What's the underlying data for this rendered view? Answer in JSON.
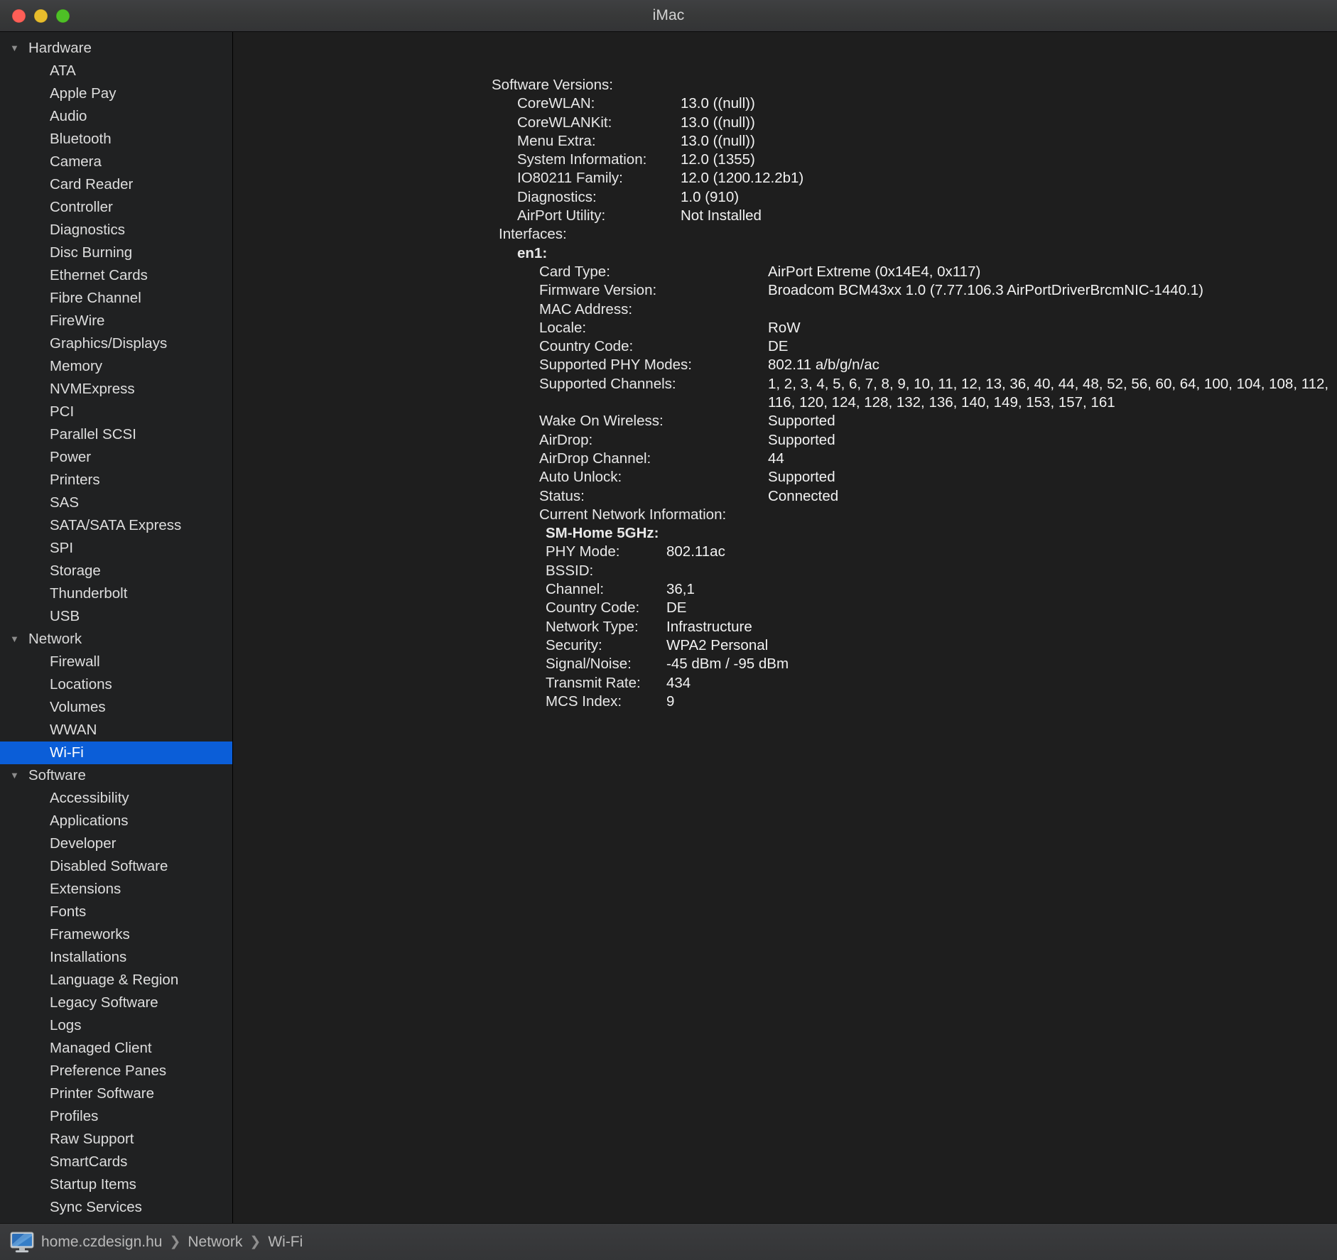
{
  "window": {
    "title": "iMac",
    "traffic_lights": [
      "close-button",
      "minimize-button",
      "zoom-button"
    ],
    "accent_selection_color": "#0b5ed8",
    "sidebar_bg": "#202122",
    "content_bg": "#1e1e1e"
  },
  "sidebar": {
    "groups": [
      {
        "label": "Hardware",
        "disclosure": "▼",
        "items": [
          "ATA",
          "Apple Pay",
          "Audio",
          "Bluetooth",
          "Camera",
          "Card Reader",
          "Controller",
          "Diagnostics",
          "Disc Burning",
          "Ethernet Cards",
          "Fibre Channel",
          "FireWire",
          "Graphics/Displays",
          "Memory",
          "NVMExpress",
          "PCI",
          "Parallel SCSI",
          "Power",
          "Printers",
          "SAS",
          "SATA/SATA Express",
          "SPI",
          "Storage",
          "Thunderbolt",
          "USB"
        ]
      },
      {
        "label": "Network",
        "disclosure": "▼",
        "items": [
          "Firewall",
          "Locations",
          "Volumes",
          "WWAN",
          "Wi-Fi"
        ]
      },
      {
        "label": "Software",
        "disclosure": "▼",
        "items": [
          "Accessibility",
          "Applications",
          "Developer",
          "Disabled Software",
          "Extensions",
          "Fonts",
          "Frameworks",
          "Installations",
          "Language & Region",
          "Legacy Software",
          "Logs",
          "Managed Client",
          "Preference Panes",
          "Printer Software",
          "Profiles",
          "Raw Support",
          "SmartCards",
          "Startup Items",
          "Sync Services"
        ]
      }
    ],
    "selected": "Wi-Fi"
  },
  "report": {
    "software_versions_heading": "Software Versions:",
    "software_versions": [
      {
        "key": "CoreWLAN:",
        "value": "13.0 ((null))"
      },
      {
        "key": "CoreWLANKit:",
        "value": "13.0 ((null))"
      },
      {
        "key": "Menu Extra:",
        "value": "13.0 ((null))"
      },
      {
        "key": "System Information:",
        "value": "12.0 (1355)"
      },
      {
        "key": "IO80211 Family:",
        "value": "12.0 (1200.12.2b1)"
      },
      {
        "key": "Diagnostics:",
        "value": "1.0 (910)"
      },
      {
        "key": "AirPort Utility:",
        "value": "Not Installed"
      }
    ],
    "interfaces_heading": "Interfaces:",
    "interface_name": "en1:",
    "interface_rows": [
      {
        "key": "Card Type:",
        "value": "AirPort Extreme  (0x14E4, 0x117)"
      },
      {
        "key": "Firmware Version:",
        "value": "Broadcom BCM43xx 1.0 (7.77.106.3 AirPortDriverBrcmNIC-1440.1)"
      },
      {
        "key": "MAC Address:",
        "value": ""
      },
      {
        "key": "Locale:",
        "value": "RoW"
      },
      {
        "key": "Country Code:",
        "value": "DE"
      },
      {
        "key": "Supported PHY Modes:",
        "value": "802.11 a/b/g/n/ac"
      }
    ],
    "supported_channels_key": "Supported Channels:",
    "supported_channels_value": "1, 2, 3, 4, 5, 6, 7, 8, 9, 10, 11, 12, 13, 36, 40, 44, 48, 52, 56, 60, 64, 100, 104, 108, 112, 116, 120, 124, 128, 132, 136, 140, 149, 153, 157, 161",
    "interface_rows_2": [
      {
        "key": "Wake On Wireless:",
        "value": "Supported"
      },
      {
        "key": "AirDrop:",
        "value": "Supported"
      },
      {
        "key": "AirDrop Channel:",
        "value": "44"
      },
      {
        "key": "Auto Unlock:",
        "value": "Supported"
      },
      {
        "key": "Status:",
        "value": "Connected"
      }
    ],
    "current_network_heading": "Current Network Information:",
    "network_name": "SM-Home 5GHz:",
    "network_rows": [
      {
        "key": "PHY Mode:",
        "value": "802.11ac"
      },
      {
        "key": "BSSID:",
        "value": ""
      },
      {
        "key": "Channel:",
        "value": "36,1"
      },
      {
        "key": "Country Code:",
        "value": "DE"
      },
      {
        "key": "Network Type:",
        "value": "Infrastructure"
      },
      {
        "key": "Security:",
        "value": "WPA2 Personal"
      },
      {
        "key": "Signal/Noise:",
        "value": "-45 dBm / -95 dBm"
      },
      {
        "key": "Transmit Rate:",
        "value": "434"
      },
      {
        "key": "MCS Index:",
        "value": "9"
      }
    ]
  },
  "statusbar": {
    "icon": "imac-computer-icon",
    "crumbs": [
      "home.czdesign.hu",
      "Network",
      "Wi-Fi"
    ],
    "separator": "❯"
  }
}
